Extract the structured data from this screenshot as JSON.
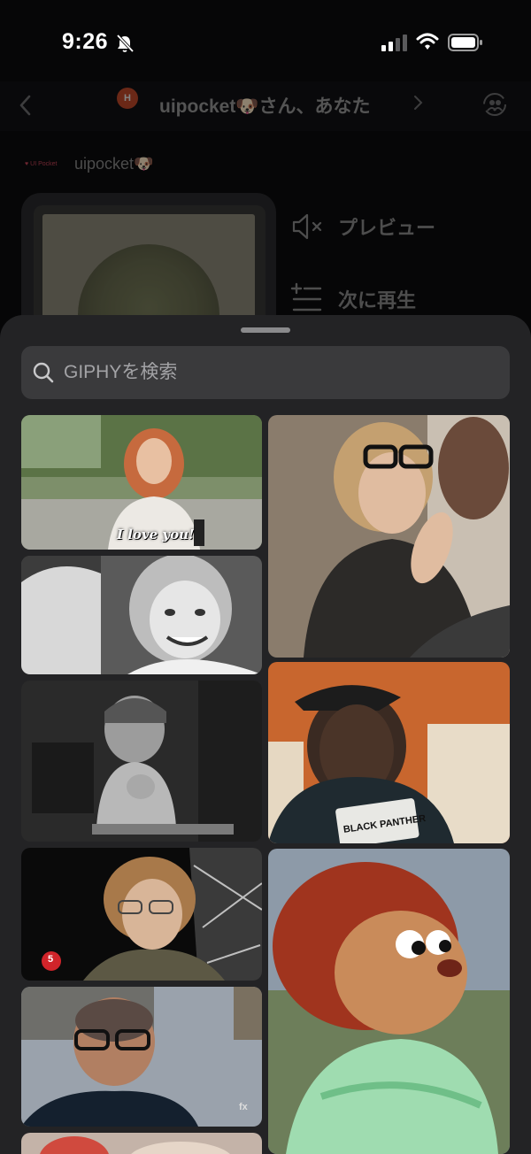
{
  "status_bar": {
    "time": "9:26"
  },
  "conversation": {
    "title": "uipocket🐶さん、あなた",
    "avatar_initials": "H"
  },
  "message": {
    "sender_logo_text": "UI Pocket",
    "sender_name": "uipocket🐶"
  },
  "action_menu": {
    "preview_label": "プレビュー",
    "play_next_label": "次に再生"
  },
  "gif_picker": {
    "search_placeholder": "GIPHYを検索",
    "results": [
      {
        "caption": "I love you!"
      },
      {
        "caption": ""
      },
      {
        "caption": ""
      },
      {
        "caption": ""
      },
      {
        "caption": ""
      },
      {
        "caption": ""
      },
      {
        "caption": ""
      },
      {
        "caption": ""
      }
    ],
    "badges": {
      "shirt_text": "BLACK PANTHER",
      "channel_5": "5",
      "channel_fx": "fx"
    }
  },
  "colors": {
    "sheet": "#232325",
    "search_field": "#3a3a3c",
    "background": "#0c0c0d"
  }
}
